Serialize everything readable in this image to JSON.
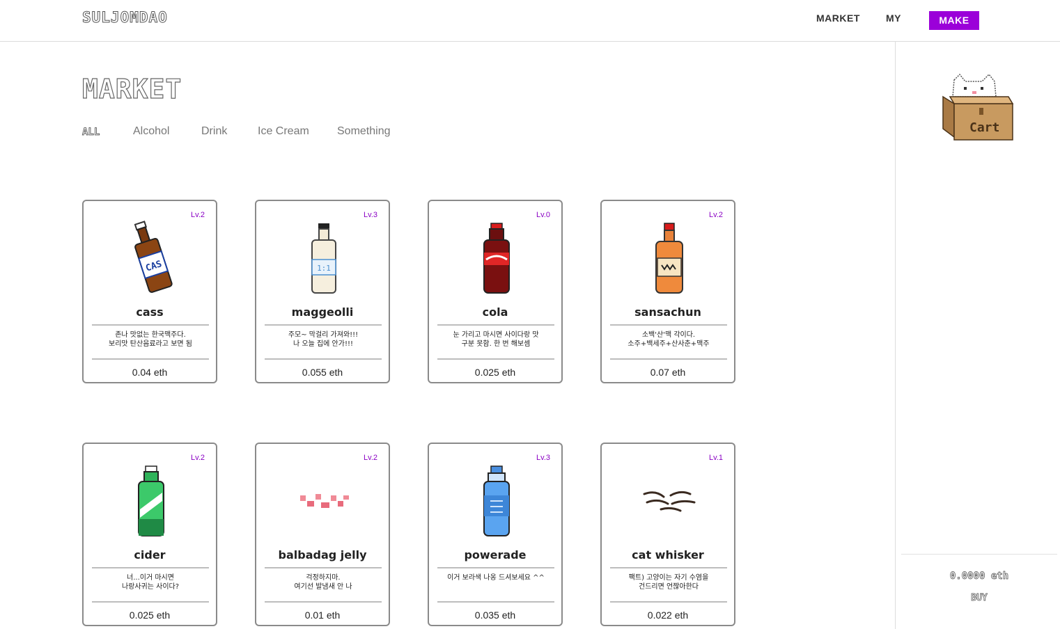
{
  "header": {
    "logo": "SULJOMDAO",
    "nav": {
      "market": "MARKET",
      "my": "MY",
      "make": "MAKE"
    }
  },
  "page": {
    "title": "MARKET",
    "filters": [
      "ALL",
      "Alcohol",
      "Drink",
      "Ice Cream",
      "Something"
    ]
  },
  "sidebar": {
    "cart_label": "Cart",
    "total": "0.0000 eth",
    "buy_label": "BUY"
  },
  "colors": {
    "accent": "#9b00d9",
    "level": "#8a00c4",
    "card_border": "#8a8a8a"
  },
  "items": [
    {
      "level": "Lv.2",
      "name": "cass",
      "desc1": "존나 맛없는 한국맥주다.",
      "desc2": "보리맛 탄산음료라고 보면 됨",
      "price": "0.04 eth",
      "icon": "beer-bottle-icon"
    },
    {
      "level": "Lv.3",
      "name": "maggeolli",
      "desc1": "주모~ 막걸리 가져와!!!",
      "desc2": "나 오늘 집에 안가!!!",
      "price": "0.055 eth",
      "icon": "makgeolli-bottle-icon"
    },
    {
      "level": "Lv.0",
      "name": "cola",
      "desc1": "눈 가리고 마시면 사이다랑 맛",
      "desc2": "구분 못함. 한 번 해보셈",
      "price": "0.025 eth",
      "icon": "cola-bottle-icon"
    },
    {
      "level": "Lv.2",
      "name": "sansachun",
      "desc1": "소백'산'맥 각이다.",
      "desc2": "소주+백세주+산사춘+맥주",
      "price": "0.07 eth",
      "icon": "sansachun-bottle-icon"
    },
    {
      "level": "Lv.2",
      "name": "cider",
      "desc1": "너...이거 마시면",
      "desc2": "나랑사귀는 사이다?",
      "price": "0.025 eth",
      "icon": "cider-bottle-icon"
    },
    {
      "level": "Lv.2",
      "name": "balbadag jelly",
      "desc1": "걱정하지마.",
      "desc2": "여기선 발냄새 안 나",
      "price": "0.01 eth",
      "icon": "jelly-icon"
    },
    {
      "level": "Lv.3",
      "name": "powerade",
      "desc1": "이거 보라색 나옹 드셔보세요 ^^",
      "desc2": "",
      "price": "0.035 eth",
      "icon": "powerade-bottle-icon"
    },
    {
      "level": "Lv.1",
      "name": "cat whisker",
      "desc1": "팩트) 고양이는 자기 수염을",
      "desc2": "건드리면 언짢아한다",
      "price": "0.022 eth",
      "icon": "cat-whisker-icon"
    }
  ]
}
